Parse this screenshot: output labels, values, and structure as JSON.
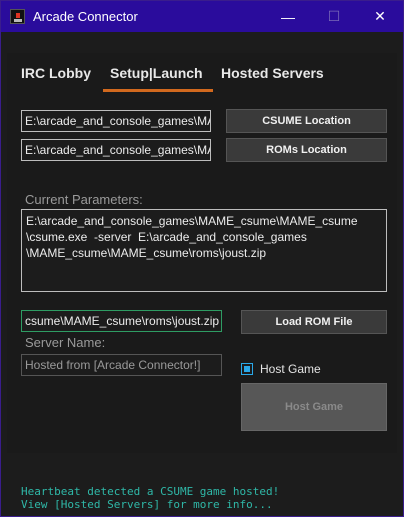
{
  "window": {
    "title": "Arcade Connector",
    "minimize": "—",
    "maximize": "☐",
    "close": "✕"
  },
  "tabs": [
    "IRC Lobby",
    "Setup|Launch",
    "Hosted Servers"
  ],
  "setup": {
    "csume_path": "E:\\arcade_and_console_games\\MAME_csume\\MAME_csume\\csume.exe",
    "roms_path": "E:\\arcade_and_console_games\\MAME_csume\\MAME_csume\\roms",
    "csume_button": "CSUME Location",
    "roms_button": "ROMs Location",
    "params_label": "Current Parameters:",
    "params_text": "E:\\arcade_and_console_games\\MAME_csume\\MAME_csume\n\\csume.exe  -server  E:\\arcade_and_console_games\n\\MAME_csume\\MAME_csume\\roms\\joust.zip",
    "rom_file": "csume\\MAME_csume\\roms\\joust.zip",
    "load_rom_button": "Load ROM File",
    "server_name_label": "Server Name:",
    "server_name_value": "Hosted from [Arcade Connector!]",
    "host_game_checkbox_label": "Host Game",
    "host_game_checked": true,
    "host_game_button": "Host Game"
  },
  "status": {
    "line1": "Heartbeat detected a CSUME game hosted!",
    "line2": "View [Hosted Servers] for more info..."
  },
  "colors": {
    "titlebar": "#2a0c9c",
    "tab_underline": "#d2691e",
    "status_text": "#2fb8a8",
    "checkbox": "#2aa8e8",
    "rom_field_border": "#2e9c63"
  }
}
